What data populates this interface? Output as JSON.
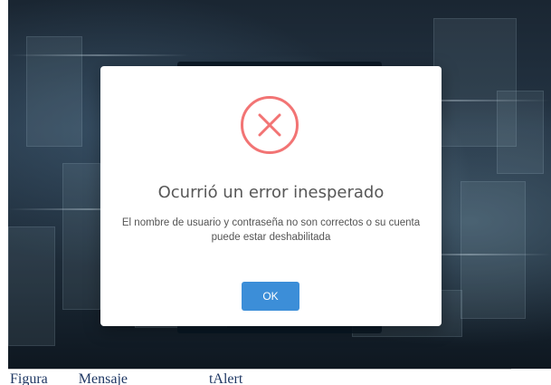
{
  "dialog": {
    "title": "Ocurrió un error inesperado",
    "message_line1": "El nombre de usuario y contraseña no son correctos o su cuenta",
    "message_line2": "puede estar deshabilitada",
    "ok_label": "OK",
    "icon": "error-x-circle-icon",
    "icon_color": "#f27474",
    "button_color": "#3c8ed8"
  },
  "caption": {
    "prefix": "Figura",
    "text": "Mensaje",
    "suffix": "tAlert"
  }
}
